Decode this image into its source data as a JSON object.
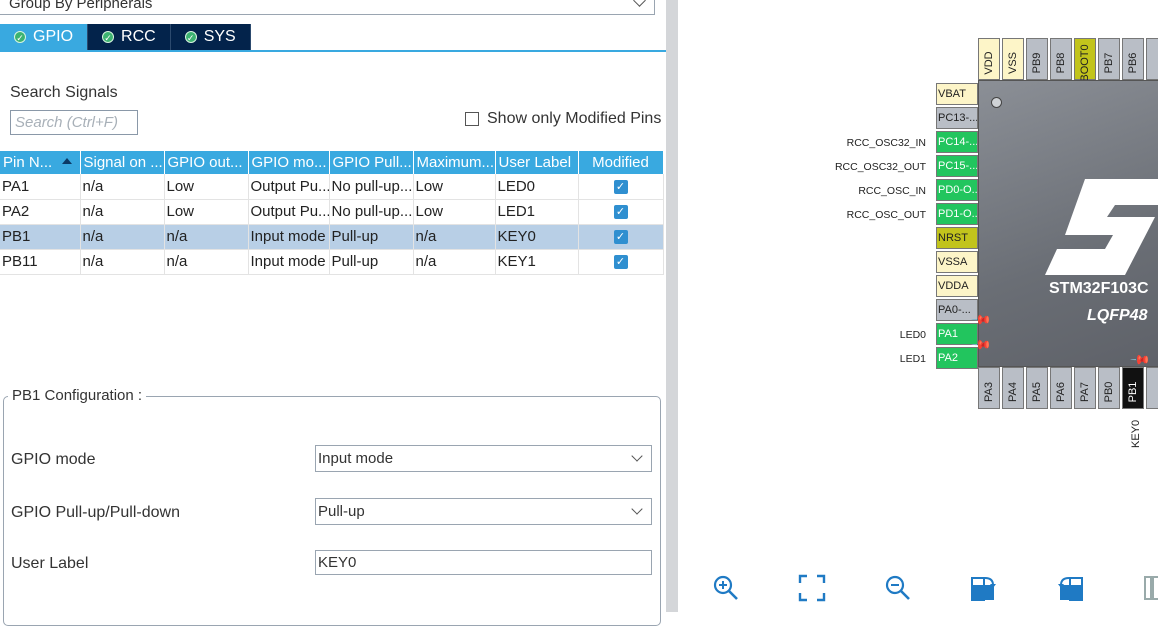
{
  "group_by": {
    "value": "Group By Peripherals"
  },
  "tabs": [
    {
      "label": "GPIO",
      "active": true
    },
    {
      "label": "RCC",
      "active": false
    },
    {
      "label": "SYS",
      "active": false
    }
  ],
  "search": {
    "label": "Search Signals",
    "placeholder": "Search (Ctrl+F)"
  },
  "show_modified": {
    "label": "Show only Modified Pins",
    "checked": false
  },
  "table": {
    "headers": [
      "Pin N...",
      "Signal on ...",
      "GPIO out...",
      "GPIO mo...",
      "GPIO Pull...",
      "Maximum...",
      "User Label",
      "Modified"
    ],
    "rows": [
      {
        "pin": "PA1",
        "signal": "n/a",
        "output": "Low",
        "mode": "Output Pu...",
        "pull": "No pull-up...",
        "max": "Low",
        "label": "LED0",
        "modified": true,
        "selected": false
      },
      {
        "pin": "PA2",
        "signal": "n/a",
        "output": "Low",
        "mode": "Output Pu...",
        "pull": "No pull-up...",
        "max": "Low",
        "label": "LED1",
        "modified": true,
        "selected": false
      },
      {
        "pin": "PB1",
        "signal": "n/a",
        "output": "n/a",
        "mode": "Input mode",
        "pull": "Pull-up",
        "max": "n/a",
        "label": "KEY0",
        "modified": true,
        "selected": true
      },
      {
        "pin": "PB11",
        "signal": "n/a",
        "output": "n/a",
        "mode": "Input mode",
        "pull": "Pull-up",
        "max": "n/a",
        "label": "KEY1",
        "modified": true,
        "selected": false
      }
    ]
  },
  "config": {
    "title": "PB1 Configuration :",
    "gpio_mode_label": "GPIO mode",
    "gpio_mode_value": "Input mode",
    "pull_label": "GPIO Pull-up/Pull-down",
    "pull_value": "Pull-up",
    "user_label_label": "User Label",
    "user_label_value": "KEY0"
  },
  "chip": {
    "name": "STM32F103C",
    "package": "LQFP48",
    "top_pins": [
      "VDD",
      "VSS",
      "PB9",
      "PB8",
      "BOOT0",
      "PB7",
      "PB6"
    ],
    "bottom_pins": [
      "PA3",
      "PA4",
      "PA5",
      "PA6",
      "PA7",
      "PB0",
      "PB1"
    ],
    "left_pins": [
      {
        "name": "VBAT",
        "signal": ""
      },
      {
        "name": "PC13-...",
        "signal": ""
      },
      {
        "name": "PC14-...",
        "signal": "RCC_OSC32_IN"
      },
      {
        "name": "PC15-...",
        "signal": "RCC_OSC32_OUT"
      },
      {
        "name": "PD0-O...",
        "signal": "RCC_OSC_IN"
      },
      {
        "name": "PD1-O...",
        "signal": "RCC_OSC_OUT"
      },
      {
        "name": "NRST",
        "signal": ""
      },
      {
        "name": "VSSA",
        "signal": ""
      },
      {
        "name": "VDDA",
        "signal": ""
      },
      {
        "name": "PA0-...",
        "signal": ""
      },
      {
        "name": "PA1",
        "signal": "LED0"
      },
      {
        "name": "PA2",
        "signal": "LED1"
      }
    ],
    "bottom_pin_label": "KEY0"
  },
  "toolbar": [
    "zoom-in-icon",
    "fit-screen-icon",
    "zoom-out-icon",
    "rotate-right-icon",
    "rotate-left-icon",
    "panel-icon"
  ]
}
